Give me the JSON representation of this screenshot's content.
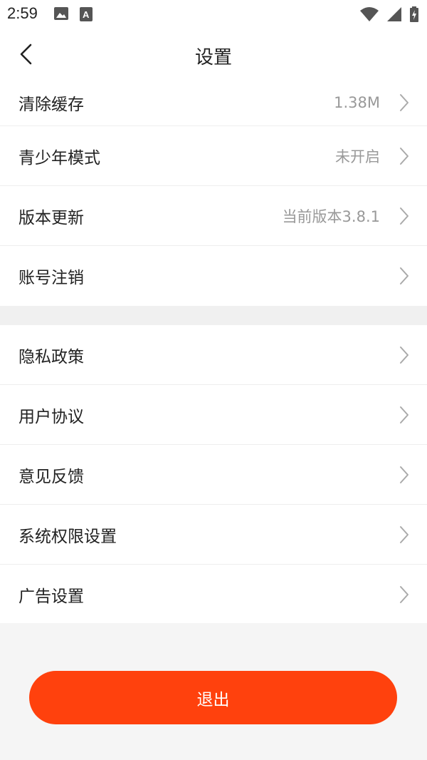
{
  "status_bar": {
    "time": "2:59",
    "icons_left": [
      "image-icon",
      "font-a-icon"
    ],
    "icons_right": [
      "wifi-icon",
      "signal-icon",
      "battery-charging-icon"
    ]
  },
  "header": {
    "title": "设置",
    "back_icon": "chevron-left-icon"
  },
  "group1": [
    {
      "label": "清除缓存",
      "value": "1.38M"
    },
    {
      "label": "青少年模式",
      "value": "未开启"
    },
    {
      "label": "版本更新",
      "value": "当前版本3.8.1"
    },
    {
      "label": "账号注销",
      "value": ""
    }
  ],
  "group2": [
    {
      "label": "隐私政策"
    },
    {
      "label": "用户协议"
    },
    {
      "label": "意见反馈"
    },
    {
      "label": "系统权限设置"
    },
    {
      "label": "广告设置"
    }
  ],
  "logout": {
    "label": "退出",
    "color": "#ff410d"
  }
}
